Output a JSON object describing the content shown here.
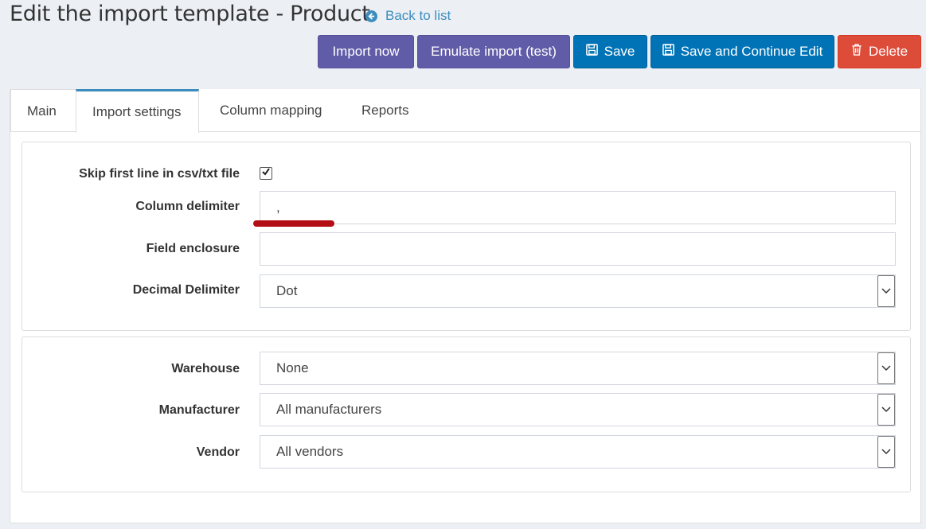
{
  "header": {
    "title": "Edit the import template - Product",
    "back_link": "Back to list"
  },
  "toolbar": {
    "import_now": "Import now",
    "emulate_import": "Emulate import (test)",
    "save": "Save",
    "save_continue": "Save and Continue Edit",
    "delete": "Delete"
  },
  "tabs": [
    {
      "label": "Main"
    },
    {
      "label": "Import settings"
    },
    {
      "label": "Column mapping"
    },
    {
      "label": "Reports"
    }
  ],
  "settings": {
    "skip_first_line_label": "Skip first line in csv/txt file",
    "skip_first_line_checked": true,
    "column_delimiter_label": "Column delimiter",
    "column_delimiter_value": ",",
    "field_enclosure_label": "Field enclosure",
    "field_enclosure_value": "",
    "decimal_delimiter_label": "Decimal Delimiter",
    "decimal_delimiter_value": "Dot"
  },
  "filters": {
    "warehouse_label": "Warehouse",
    "warehouse_value": "None",
    "manufacturer_label": "Manufacturer",
    "manufacturer_value": "All manufacturers",
    "vendor_label": "Vendor",
    "vendor_value": "All vendors"
  },
  "colors": {
    "accent": "#3c8dbc",
    "purple": "#605ca8",
    "blue": "#0073b7",
    "red": "#dd4b39",
    "annotation": "#b30e14"
  }
}
